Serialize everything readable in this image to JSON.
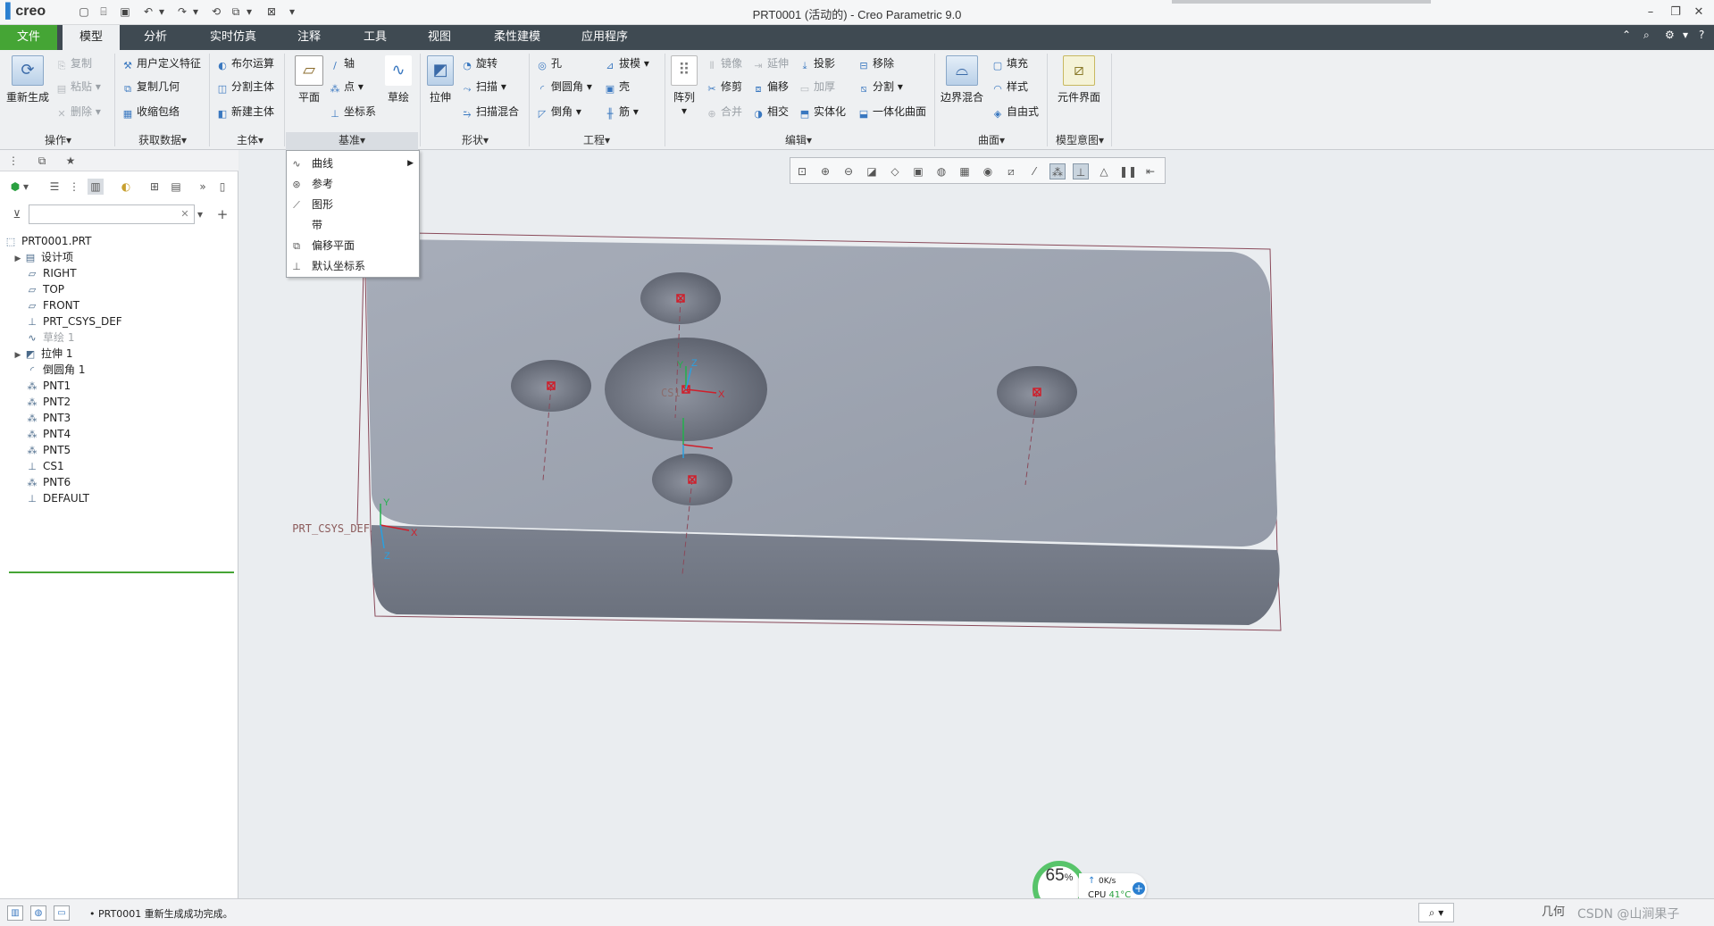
{
  "app": {
    "logo": "creo",
    "window_title": "PRT0001 (活动的) - Creo Parametric 9.0"
  },
  "menu": {
    "tabs": [
      "文件",
      "模型",
      "分析",
      "实时仿真",
      "注释",
      "工具",
      "视图",
      "柔性建模",
      "应用程序"
    ]
  },
  "ribbon": {
    "operations": {
      "regen": "重新生成",
      "copy": "复制",
      "paste": "粘贴",
      "delete": "删除",
      "group": "操作"
    },
    "get_data": {
      "udf": "用户定义特征",
      "copy_geom": "复制几何",
      "shrinkwrap": "收缩包络",
      "group": "获取数据"
    },
    "body": {
      "boolean": "布尔运算",
      "split_body": "分割主体",
      "new_body": "新建主体",
      "group": "主体"
    },
    "datum": {
      "plane": "平面",
      "axis": "轴",
      "point": "点",
      "csys": "坐标系",
      "sketch": "草绘",
      "group": "基准"
    },
    "shapes": {
      "extrude": "拉伸",
      "revolve": "旋转",
      "sweep": "扫描",
      "swept_blend": "扫描混合",
      "group": "形状"
    },
    "engineering": {
      "hole": "孔",
      "draft": "拔模",
      "round": "倒圆角",
      "shell": "壳",
      "chamfer": "倒角",
      "rib": "筋",
      "group": "工程"
    },
    "editing": {
      "pattern": "阵列",
      "mirror": "镜像",
      "extend": "延伸",
      "project": "投影",
      "remove": "移除",
      "trim": "修剪",
      "offset": "偏移",
      "thicken": "加厚",
      "split": "分割",
      "merge": "合并",
      "intersect": "相交",
      "solidify": "实体化",
      "unify": "一体化曲面",
      "group": "编辑"
    },
    "surfaces": {
      "boundary_blend": "边界混合",
      "fill": "填充",
      "style": "样式",
      "freestyle": "自由式",
      "group": "曲面"
    },
    "model_intent": {
      "component_interface": "元件界面",
      "group": "模型意图"
    }
  },
  "datum_dropdown": {
    "items": [
      "曲线",
      "参考",
      "图形",
      "带",
      "偏移平面",
      "默认坐标系"
    ]
  },
  "model_tree": {
    "filter_placeholder": "",
    "items": [
      {
        "label": "PRT0001.PRT",
        "icon": "part-icon",
        "expandable": false,
        "indent": 0,
        "dim": false
      },
      {
        "label": "设计项",
        "icon": "design-items-icon",
        "expandable": true,
        "indent": 1,
        "dim": false
      },
      {
        "label": "RIGHT",
        "icon": "datum-plane-icon",
        "expandable": false,
        "indent": 1,
        "dim": false
      },
      {
        "label": "TOP",
        "icon": "datum-plane-icon",
        "expandable": false,
        "indent": 1,
        "dim": false
      },
      {
        "label": "FRONT",
        "icon": "datum-plane-icon",
        "expandable": false,
        "indent": 1,
        "dim": false
      },
      {
        "label": "PRT_CSYS_DEF",
        "icon": "csys-icon",
        "expandable": false,
        "indent": 1,
        "dim": false
      },
      {
        "label": "草绘 1",
        "icon": "sketch-icon",
        "expandable": false,
        "indent": 1,
        "dim": true
      },
      {
        "label": "拉伸 1",
        "icon": "extrude-icon",
        "expandable": true,
        "indent": 1,
        "dim": false
      },
      {
        "label": "倒圆角 1",
        "icon": "round-icon",
        "expandable": false,
        "indent": 1,
        "dim": false
      },
      {
        "label": "PNT1",
        "icon": "datum-point-icon",
        "expandable": false,
        "indent": 1,
        "dim": false
      },
      {
        "label": "PNT2",
        "icon": "datum-point-icon",
        "expandable": false,
        "indent": 1,
        "dim": false
      },
      {
        "label": "PNT3",
        "icon": "datum-point-icon",
        "expandable": false,
        "indent": 1,
        "dim": false
      },
      {
        "label": "PNT4",
        "icon": "datum-point-icon",
        "expandable": false,
        "indent": 1,
        "dim": false
      },
      {
        "label": "PNT5",
        "icon": "datum-point-icon",
        "expandable": false,
        "indent": 1,
        "dim": false
      },
      {
        "label": "CS1",
        "icon": "csys-icon",
        "expandable": false,
        "indent": 1,
        "dim": false
      },
      {
        "label": "PNT6",
        "icon": "datum-point-icon",
        "expandable": false,
        "indent": 1,
        "dim": false
      },
      {
        "label": "DEFAULT",
        "icon": "csys-icon",
        "expandable": false,
        "indent": 1,
        "dim": false
      }
    ]
  },
  "viewport": {
    "csys_label": "PRT_CSYS_DEF",
    "cs_label": "CS1",
    "axis_labels": {
      "x": "X",
      "y": "Y",
      "z": "Z"
    },
    "model_color": "#9aa0ad"
  },
  "status": {
    "message": "PRT0001 重新生成成功完成。",
    "filter": "几何",
    "watermark": "CSDN @山涧果子"
  },
  "perf": {
    "percent": "65",
    "unit": "%",
    "net": "0K/s",
    "cpu_label": "CPU",
    "cpu_temp": "41°C"
  },
  "colors": {
    "file_tab": "#45a535",
    "menubar": "#3f4a52",
    "accent": "#2a7fd0"
  }
}
